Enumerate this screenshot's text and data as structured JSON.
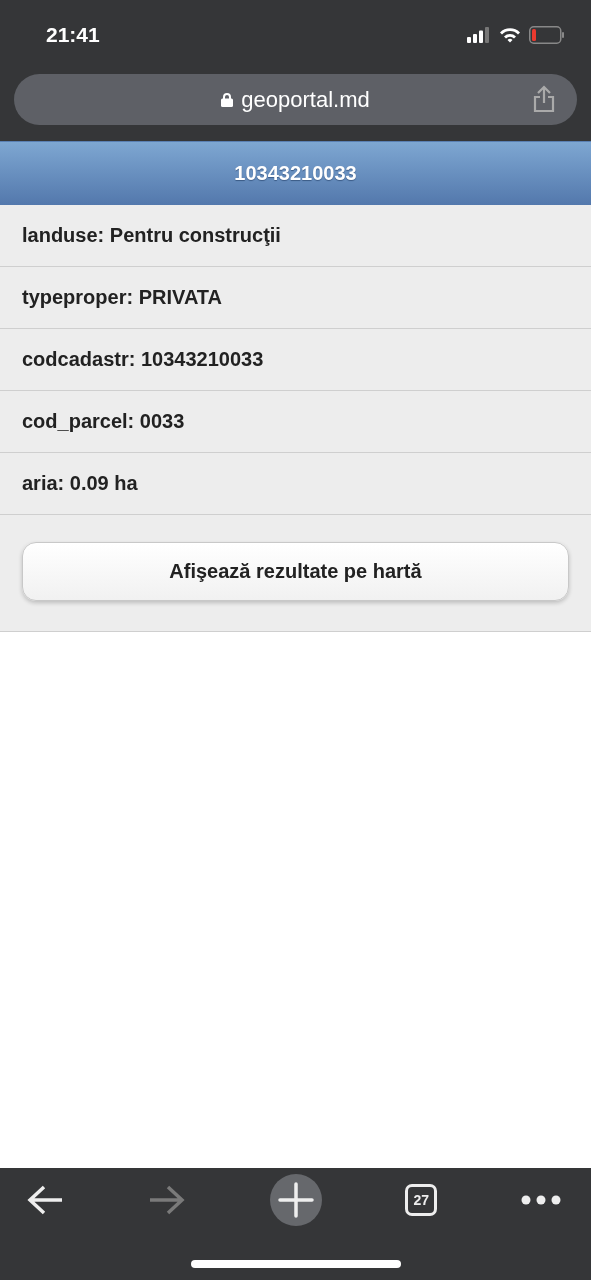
{
  "status_bar": {
    "time": "21:41"
  },
  "address_bar": {
    "url": "geoportal.md"
  },
  "header": {
    "title": "10343210033"
  },
  "fields": [
    {
      "text": "landuse: Pentru construcţii"
    },
    {
      "text": "typeproper: PRIVATA"
    },
    {
      "text": "codcadastr: 10343210033"
    },
    {
      "text": "cod_parcel: 0033"
    },
    {
      "text": "aria: 0.09 ha"
    }
  ],
  "show_on_map_button": "Afişează rezultate pe hartă",
  "toolbar": {
    "items": [
      {
        "kind": "back",
        "disabled": false
      },
      {
        "kind": "forward",
        "disabled": true
      },
      {
        "kind": "new-tab",
        "disabled": false
      },
      {
        "kind": "tabs",
        "label": "27",
        "disabled": false
      },
      {
        "kind": "more",
        "disabled": false
      }
    ]
  }
}
